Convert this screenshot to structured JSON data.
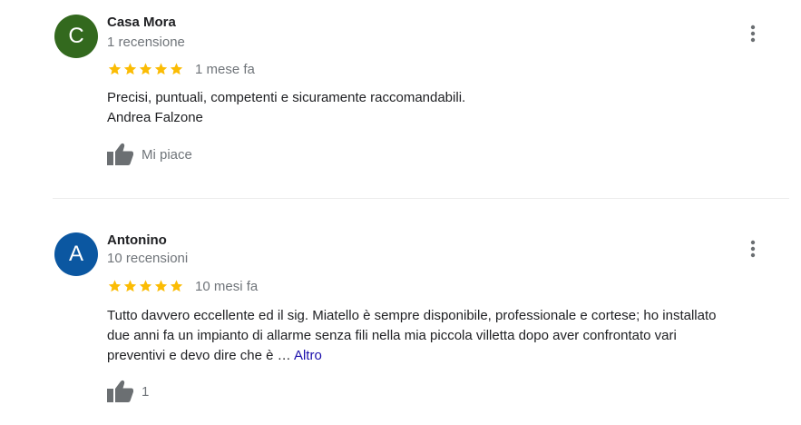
{
  "colors": {
    "avatar_casa_mora": "#33691e",
    "avatar_antonino": "#0b57a1",
    "star": "#fbbc04",
    "link": "#1a0dab",
    "muted": "#70757a",
    "icon": "#6b6f72"
  },
  "reviews": [
    {
      "initial": "C",
      "name": "Casa Mora",
      "review_count": "1 recensione",
      "rating": 5,
      "date": "1 mese fa",
      "text_lines": [
        "Precisi, puntuali, competenti e sicuramente raccomandabili.",
        "Andrea Falzone"
      ],
      "like_label": "Mi piace",
      "icons": {
        "like": "thumbs-up-icon",
        "menu": "more-vert-icon",
        "star": "star-icon"
      }
    },
    {
      "initial": "A",
      "name": "Antonino",
      "review_count": "10 recensioni",
      "rating": 5,
      "date": "10 mesi fa",
      "text_lines": [
        "Tutto davvero eccellente ed il sig. Miatello è sempre disponibile, professionale e cortese;  ho installato",
        "due anni fa un impianto di allarme senza fili nella mia piccola villetta dopo aver confrontato vari",
        "preventivi e devo dire che è …"
      ],
      "more_label": "Altro",
      "like_label": "1",
      "icons": {
        "like": "thumbs-up-icon",
        "menu": "more-vert-icon",
        "star": "star-icon"
      }
    }
  ]
}
